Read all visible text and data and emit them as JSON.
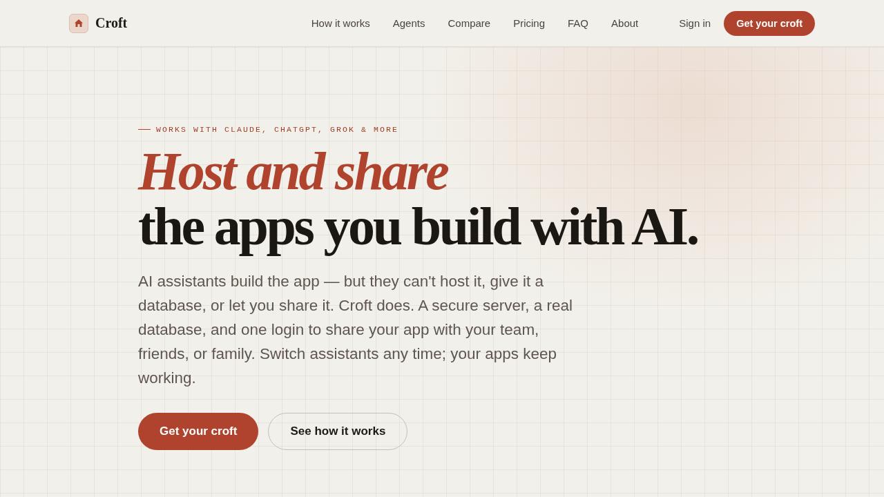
{
  "header": {
    "brand": "Croft",
    "nav": [
      "How it works",
      "Agents",
      "Compare",
      "Pricing",
      "FAQ",
      "About"
    ],
    "sign_in": "Sign in",
    "cta": "Get your croft"
  },
  "hero": {
    "eyebrow": "WORKS WITH CLAUDE, CHATGPT, GROK & MORE",
    "title_accent": "Host and share",
    "title": "the apps you build with AI.",
    "body": "AI assistants build the app — but they can't host it, give it a database, or let you share it. Croft does. A secure server, a real database, and one login to share your app with your team, friends, or family. Switch assistants any time; your apps keep working.",
    "buttons": [
      {
        "label": "Get your croft",
        "kind": "primary"
      },
      {
        "label": "See how it works",
        "kind": "secondary"
      }
    ]
  }
}
